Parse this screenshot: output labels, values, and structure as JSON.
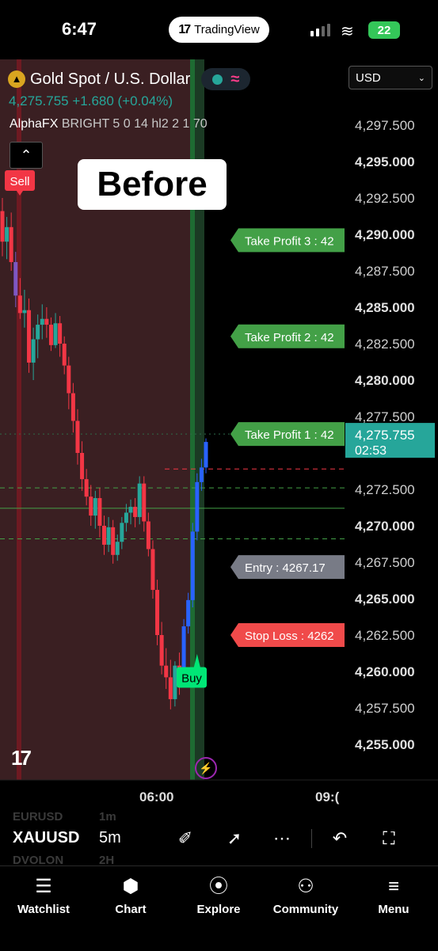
{
  "status_bar": {
    "time": "6:47",
    "app_badge": "TradingView",
    "battery": "22"
  },
  "header": {
    "symbol_title": "Gold Spot / U.S. Dollar",
    "price_text": "4,275.755 +1.680 (+0.04%)",
    "indicator_name": "AlphaFX",
    "indicator_params": "BRIGHT 5 0 14 hl2 2 1 70",
    "currency": "USD"
  },
  "annotation": {
    "before_label": "Before"
  },
  "signals": {
    "sell": "Sell",
    "buy": "Buy"
  },
  "levels": {
    "tp3": "Take Profit 3 : 42",
    "tp2": "Take Profit 2 : 42",
    "tp1": "Take Profit 1 : 42",
    "entry": "Entry : 4267.17",
    "stop_loss": "Stop Loss : 4262"
  },
  "price_axis": {
    "ticks": [
      "4,297.500",
      "4,295.000",
      "4,292.500",
      "4,290.000",
      "4,287.500",
      "4,285.000",
      "4,282.500",
      "4,280.000",
      "4,277.500",
      "4,275.755",
      "4,272.500",
      "4,270.000",
      "4,267.500",
      "4,265.000",
      "4,262.500",
      "4,260.000",
      "4,257.500",
      "4,255.000"
    ],
    "current_price": "4,275.755",
    "countdown": "02:53"
  },
  "time_axis": {
    "labels": [
      "06:00",
      "09:("
    ]
  },
  "toolbar": {
    "symbol": "XAUUSD",
    "interval": "5m",
    "ghost_symbols": [
      "EURUSD",
      "DVOLON"
    ],
    "ghost_intervals": [
      "1m",
      "2H"
    ]
  },
  "bottom_nav": {
    "items": [
      {
        "label": "Watchlist",
        "icon": "watchlist-icon"
      },
      {
        "label": "Chart",
        "icon": "chart-icon"
      },
      {
        "label": "Explore",
        "icon": "compass-icon"
      },
      {
        "label": "Community",
        "icon": "community-icon"
      },
      {
        "label": "Menu",
        "icon": "menu-icon"
      }
    ]
  },
  "colors": {
    "bull": "#26a69a",
    "bear": "#f23645",
    "signal_buy": "#00e676",
    "signal_sell": "#f23645",
    "tp_label": "#43a047",
    "entry_label": "#787b86",
    "sl_label": "#f04a4a",
    "bear_zone": "#3a1f22",
    "bull_zone": "#1b3a24"
  },
  "chart_data": {
    "type": "candlestick",
    "title": "Gold Spot / U.S. Dollar",
    "interval": "5m",
    "ylim": [
      4253.5,
      4299.0
    ],
    "price_levels": [
      {
        "name": "Take Profit 3",
        "value": 4289.6
      },
      {
        "name": "Take Profit 2",
        "value": 4283.0
      },
      {
        "name": "Take Profit 1",
        "value": 4276.3
      },
      {
        "name": "Entry",
        "value": 4267.17
      },
      {
        "name": "Stop Loss",
        "value": 4262.5
      }
    ],
    "signals": [
      {
        "type": "Sell",
        "index": 3
      },
      {
        "type": "Buy",
        "index": 44
      }
    ],
    "candles": [
      {
        "o": 4291.6,
        "h": 4292.5,
        "l": 4288.5,
        "c": 4289.5
      },
      {
        "o": 4289.5,
        "h": 4291.2,
        "l": 4288.3,
        "c": 4290.5
      },
      {
        "o": 4290.5,
        "h": 4291.5,
        "l": 4287.5,
        "c": 4288.1
      },
      {
        "o": 4288.1,
        "h": 4288.8,
        "l": 4285.0,
        "c": 4285.8
      },
      {
        "o": 4285.8,
        "h": 4287.0,
        "l": 4284.2,
        "c": 4284.6
      },
      {
        "o": 4284.6,
        "h": 4286.2,
        "l": 4283.6,
        "c": 4284.8
      },
      {
        "o": 4284.8,
        "h": 4285.6,
        "l": 4280.5,
        "c": 4281.2
      },
      {
        "o": 4281.2,
        "h": 4283.6,
        "l": 4280.0,
        "c": 4282.8
      },
      {
        "o": 4282.8,
        "h": 4284.5,
        "l": 4281.5,
        "c": 4283.8
      },
      {
        "o": 4283.8,
        "h": 4285.2,
        "l": 4282.8,
        "c": 4284.2
      },
      {
        "o": 4284.2,
        "h": 4285.0,
        "l": 4282.9,
        "c": 4283.8
      },
      {
        "o": 4283.8,
        "h": 4284.3,
        "l": 4282.0,
        "c": 4282.4
      },
      {
        "o": 4282.4,
        "h": 4284.6,
        "l": 4282.2,
        "c": 4283.9
      },
      {
        "o": 4283.9,
        "h": 4284.4,
        "l": 4281.6,
        "c": 4282.5
      },
      {
        "o": 4282.5,
        "h": 4283.0,
        "l": 4280.4,
        "c": 4281.0
      },
      {
        "o": 4281.0,
        "h": 4281.6,
        "l": 4278.0,
        "c": 4279.1
      },
      {
        "o": 4279.1,
        "h": 4279.8,
        "l": 4276.4,
        "c": 4277.2
      },
      {
        "o": 4277.2,
        "h": 4278.0,
        "l": 4274.2,
        "c": 4275.0
      },
      {
        "o": 4275.0,
        "h": 4275.8,
        "l": 4272.4,
        "c": 4273.2
      },
      {
        "o": 4273.2,
        "h": 4273.9,
        "l": 4271.4,
        "c": 4272.0
      },
      {
        "o": 4272.0,
        "h": 4272.8,
        "l": 4270.0,
        "c": 4270.7
      },
      {
        "o": 4270.7,
        "h": 4272.4,
        "l": 4269.8,
        "c": 4271.9
      },
      {
        "o": 4271.9,
        "h": 4272.6,
        "l": 4269.2,
        "c": 4270.0
      },
      {
        "o": 4270.0,
        "h": 4270.7,
        "l": 4268.0,
        "c": 4268.7
      },
      {
        "o": 4268.7,
        "h": 4270.6,
        "l": 4268.2,
        "c": 4269.9
      },
      {
        "o": 4269.9,
        "h": 4270.4,
        "l": 4267.4,
        "c": 4268.0
      },
      {
        "o": 4268.0,
        "h": 4269.4,
        "l": 4267.6,
        "c": 4268.9
      },
      {
        "o": 4268.9,
        "h": 4270.6,
        "l": 4268.4,
        "c": 4270.2
      },
      {
        "o": 4270.2,
        "h": 4271.5,
        "l": 4269.6,
        "c": 4270.9
      },
      {
        "o": 4270.9,
        "h": 4271.8,
        "l": 4270.1,
        "c": 4271.3
      },
      {
        "o": 4271.3,
        "h": 4271.9,
        "l": 4269.9,
        "c": 4270.6
      },
      {
        "o": 4270.6,
        "h": 4273.4,
        "l": 4270.1,
        "c": 4272.9
      },
      {
        "o": 4272.9,
        "h": 4273.4,
        "l": 4269.6,
        "c": 4270.3
      },
      {
        "o": 4270.3,
        "h": 4270.9,
        "l": 4267.9,
        "c": 4268.4
      },
      {
        "o": 4268.4,
        "h": 4269.0,
        "l": 4265.0,
        "c": 4265.6
      },
      {
        "o": 4265.6,
        "h": 4266.3,
        "l": 4261.8,
        "c": 4262.5
      },
      {
        "o": 4262.5,
        "h": 4263.4,
        "l": 4259.8,
        "c": 4260.4
      },
      {
        "o": 4260.4,
        "h": 4261.6,
        "l": 4258.8,
        "c": 4259.6
      },
      {
        "o": 4259.6,
        "h": 4260.8,
        "l": 4257.4,
        "c": 4258.1
      },
      {
        "o": 4258.1,
        "h": 4260.7,
        "l": 4257.6,
        "c": 4260.4
      },
      {
        "o": 4260.4,
        "h": 4261.3,
        "l": 4258.4,
        "c": 4259.2
      },
      {
        "o": 4259.2,
        "h": 4263.6,
        "l": 4258.9,
        "c": 4263.1
      },
      {
        "o": 4263.1,
        "h": 4265.4,
        "l": 4262.6,
        "c": 4264.9
      },
      {
        "o": 4264.9,
        "h": 4270.2,
        "l": 4264.4,
        "c": 4269.6
      },
      {
        "o": 4269.6,
        "h": 4273.6,
        "l": 4269.0,
        "c": 4273.0
      },
      {
        "o": 4273.0,
        "h": 4274.6,
        "l": 4272.4,
        "c": 4274.0
      },
      {
        "o": 4274.0,
        "h": 4276.0,
        "l": 4273.6,
        "c": 4275.755
      }
    ]
  }
}
